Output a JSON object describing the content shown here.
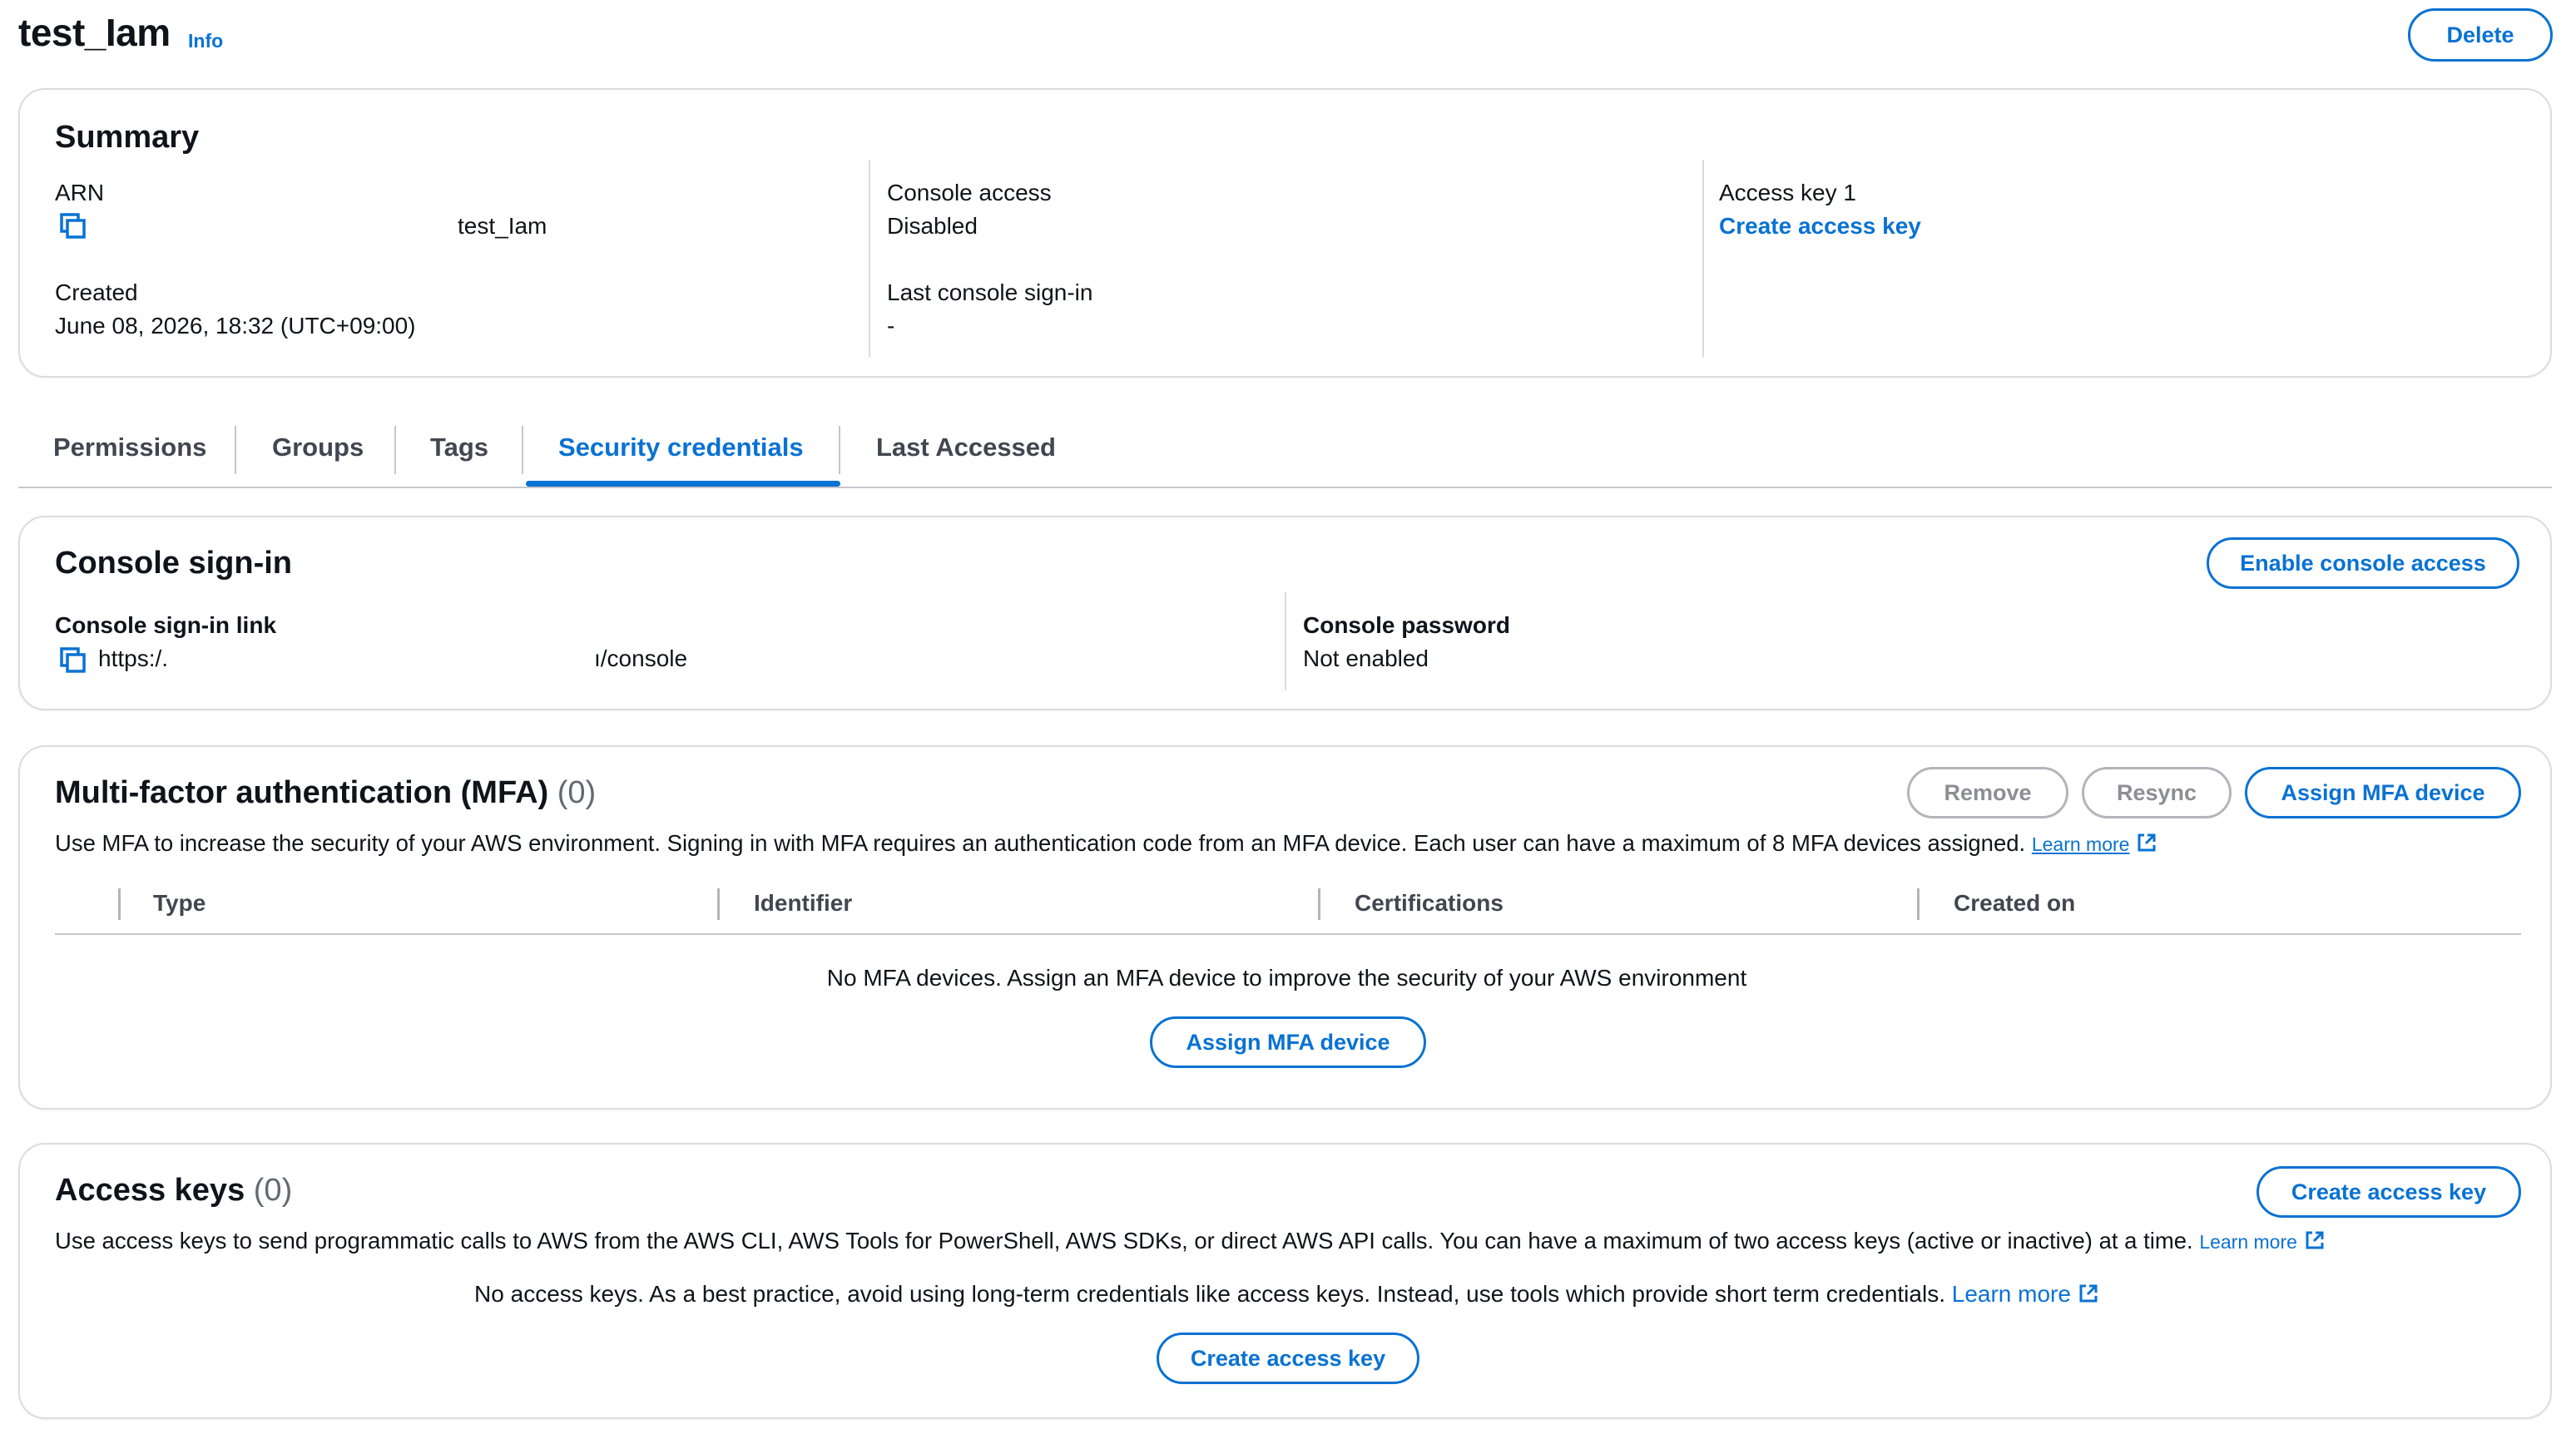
{
  "header": {
    "title": "test_Iam",
    "info_label": "Info",
    "delete_label": "Delete"
  },
  "summary": {
    "title": "Summary",
    "arn_label": "ARN",
    "arn_value": "test_Iam",
    "created_label": "Created",
    "created_value": "June 08, 2026, 18:32 (UTC+09:00)",
    "console_access_label": "Console access",
    "console_access_value": "Disabled",
    "last_signin_label": "Last console sign-in",
    "last_signin_value": "-",
    "access_key_label": "Access key 1",
    "access_key_link": "Create access key"
  },
  "tabs": [
    {
      "label": "Permissions"
    },
    {
      "label": "Groups"
    },
    {
      "label": "Tags"
    },
    {
      "label": "Security credentials"
    },
    {
      "label": "Last Accessed"
    }
  ],
  "active_tab": "Security credentials",
  "console_signin": {
    "title": "Console sign-in",
    "enable_button": "Enable console access",
    "link_label": "Console sign-in link",
    "link_prefix": "https:/.",
    "link_suffix": "ı/console",
    "password_label": "Console password",
    "password_value": "Not enabled"
  },
  "mfa": {
    "title": "Multi-factor authentication (MFA)",
    "count": "(0)",
    "remove_button": "Remove",
    "resync_button": "Resync",
    "assign_button": "Assign MFA device",
    "description": "Use MFA to increase the security of your AWS environment. Signing in with MFA requires an authentication code from an MFA device. Each user can have a maximum of 8 MFA devices assigned.",
    "learn_more": "Learn more",
    "columns": [
      "Type",
      "Identifier",
      "Certifications",
      "Created on"
    ],
    "empty_message": "No MFA devices. Assign an MFA device to improve the security of your AWS environment",
    "empty_assign_button": "Assign MFA device"
  },
  "access_keys": {
    "title": "Access keys",
    "count": "(0)",
    "create_button": "Create access key",
    "description": "Use access keys to send programmatic calls to AWS from the AWS CLI, AWS Tools for PowerShell, AWS SDKs, or direct AWS API calls. You can have a maximum of two access keys (active or inactive) at a time.",
    "learn_more": "Learn more",
    "empty_message": "No access keys. As a best practice, avoid using long-term credentials like access keys. Instead, use tools which provide short term credentials.",
    "empty_learn_more": "Learn more",
    "empty_create_button": "Create access key"
  },
  "colors": {
    "accent": "#0972d3",
    "text": "#0f141a",
    "muted": "#656871",
    "border": "#dcdcdf",
    "disabled": "#8d8d94"
  },
  "icons": [
    "copy-icon",
    "external-link-icon"
  ]
}
